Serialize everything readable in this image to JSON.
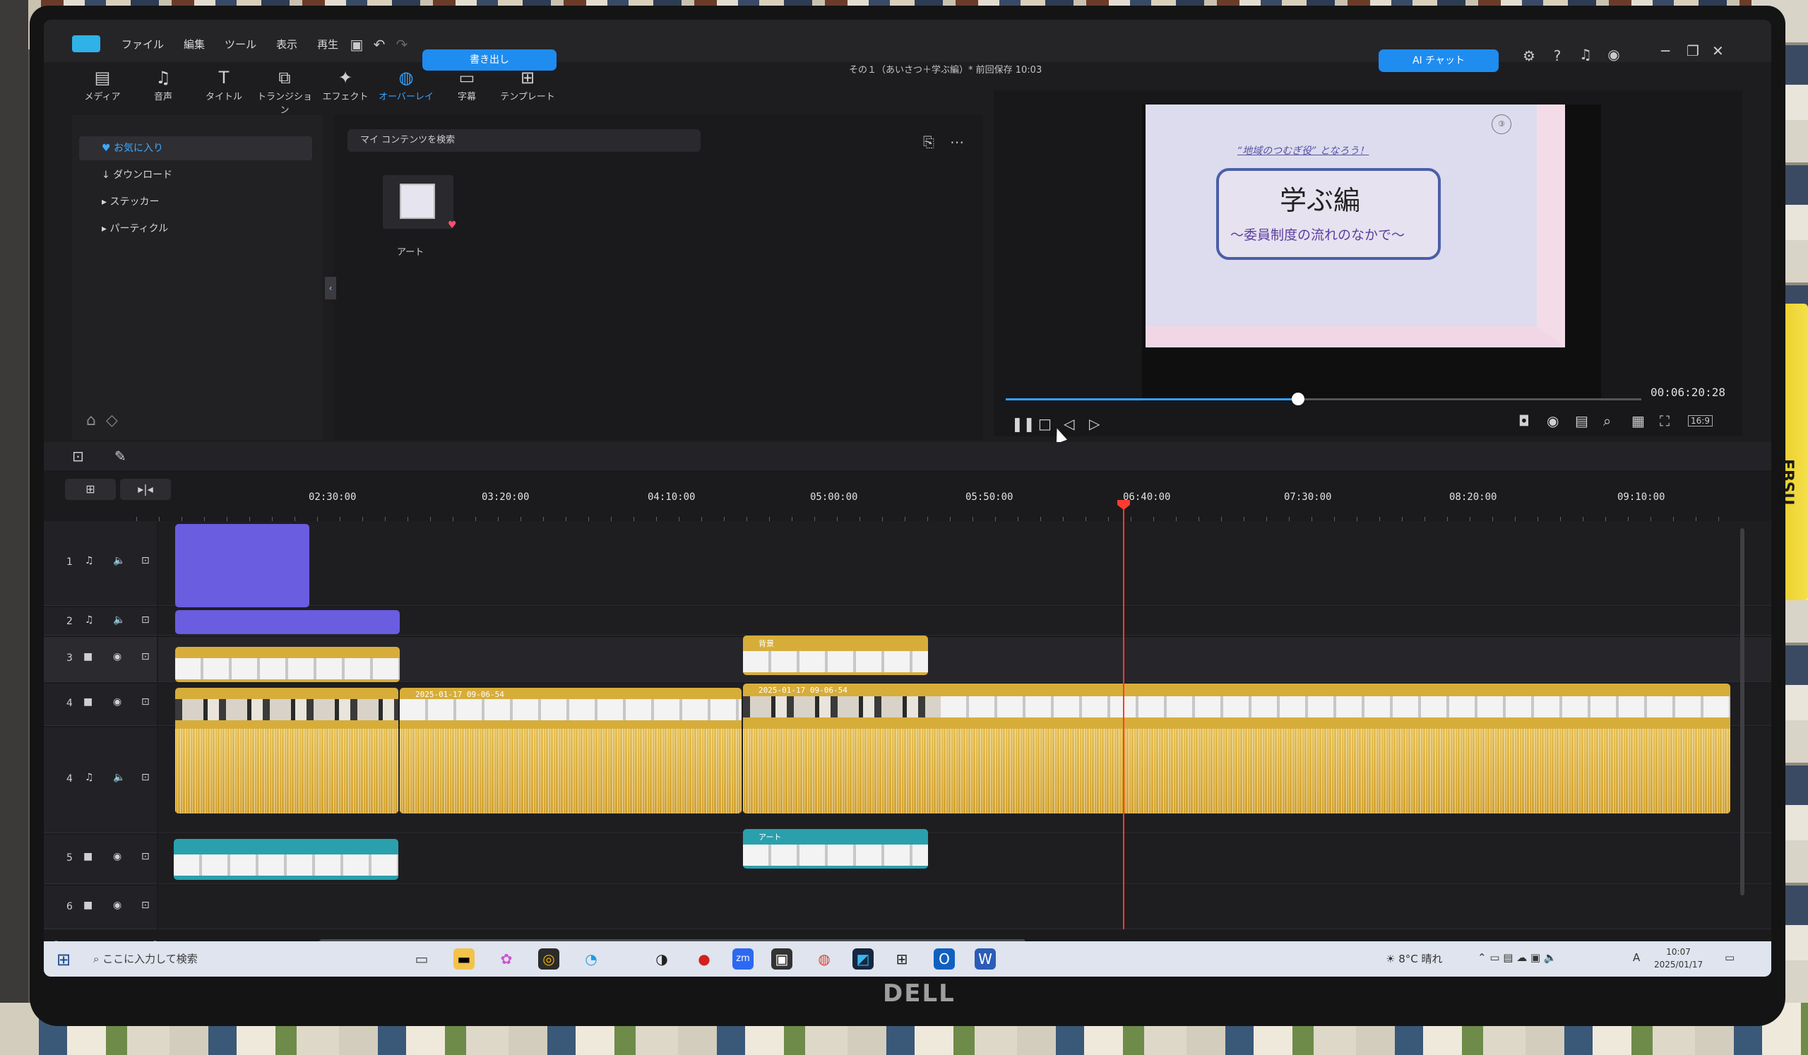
{
  "app": {
    "menu": [
      "ファイル",
      "編集",
      "ツール",
      "表示",
      "再生"
    ],
    "export_label": "書き出し",
    "project_title": "その１（あいさつ＋学ぶ編）* 前回保存 10:03",
    "ai_label": "AI チャット"
  },
  "tabs": [
    {
      "label": "メディア",
      "icon": "media-icon"
    },
    {
      "label": "音声",
      "icon": "music-icon"
    },
    {
      "label": "タイトル",
      "icon": "title-icon"
    },
    {
      "label": "トランジション",
      "icon": "transition-icon"
    },
    {
      "label": "エフェクト",
      "icon": "effect-icon"
    },
    {
      "label": "オーバーレイ",
      "icon": "overlay-icon",
      "active": true
    },
    {
      "label": "字幕",
      "icon": "subtitle-icon"
    },
    {
      "label": "テンプレート",
      "icon": "template-icon"
    }
  ],
  "library": {
    "sidebar": [
      "お気に入り",
      "ダウンロード",
      "ステッカー",
      "パーティクル"
    ],
    "search_placeholder": "マイ コンテンツを検索",
    "item_label": "アート"
  },
  "preview": {
    "slide_subtitle": "“地域のつむぎ役” となろう！",
    "slide_title": "学ぶ編",
    "slide_line": "〜委員制度の流れのなかで〜",
    "slide_badge": "③",
    "timecode": "00:06:20:28",
    "progress": 0.46
  },
  "timeline": {
    "ruler": [
      "02:30:00",
      "03:20:00",
      "04:10:00",
      "05:00:00",
      "05:50:00",
      "06:40:00",
      "07:30:00",
      "08:20:00",
      "09:10:00"
    ],
    "tracks": [
      {
        "num": "1",
        "type": "audio"
      },
      {
        "num": "2",
        "type": "audio"
      },
      {
        "num": "3",
        "type": "video"
      },
      {
        "num": "4",
        "type": "video"
      },
      {
        "num": "4",
        "type": "audio"
      },
      {
        "num": "5",
        "type": "video"
      },
      {
        "num": "6",
        "type": "video"
      }
    ],
    "clip_bg": "背景",
    "clip_video_a": "2025-01-17 09-06-54",
    "clip_video_b": "2025-01-17 09-06-54",
    "clip_art": "アート"
  },
  "taskbar": {
    "search": "ここに入力して検索",
    "weather": "8°C 晴れ",
    "ime": "A",
    "time": "10:07",
    "date": "2025/01/17"
  },
  "colors": {
    "accent": "#1f8cf0",
    "audio_clip": "#6a5de0",
    "video_clip": "#d7ad3a",
    "overlay_clip": "#2aa0ad",
    "playhead": "#ff3b30"
  },
  "monitor_brand": "DELL",
  "device_label": "EBSU"
}
